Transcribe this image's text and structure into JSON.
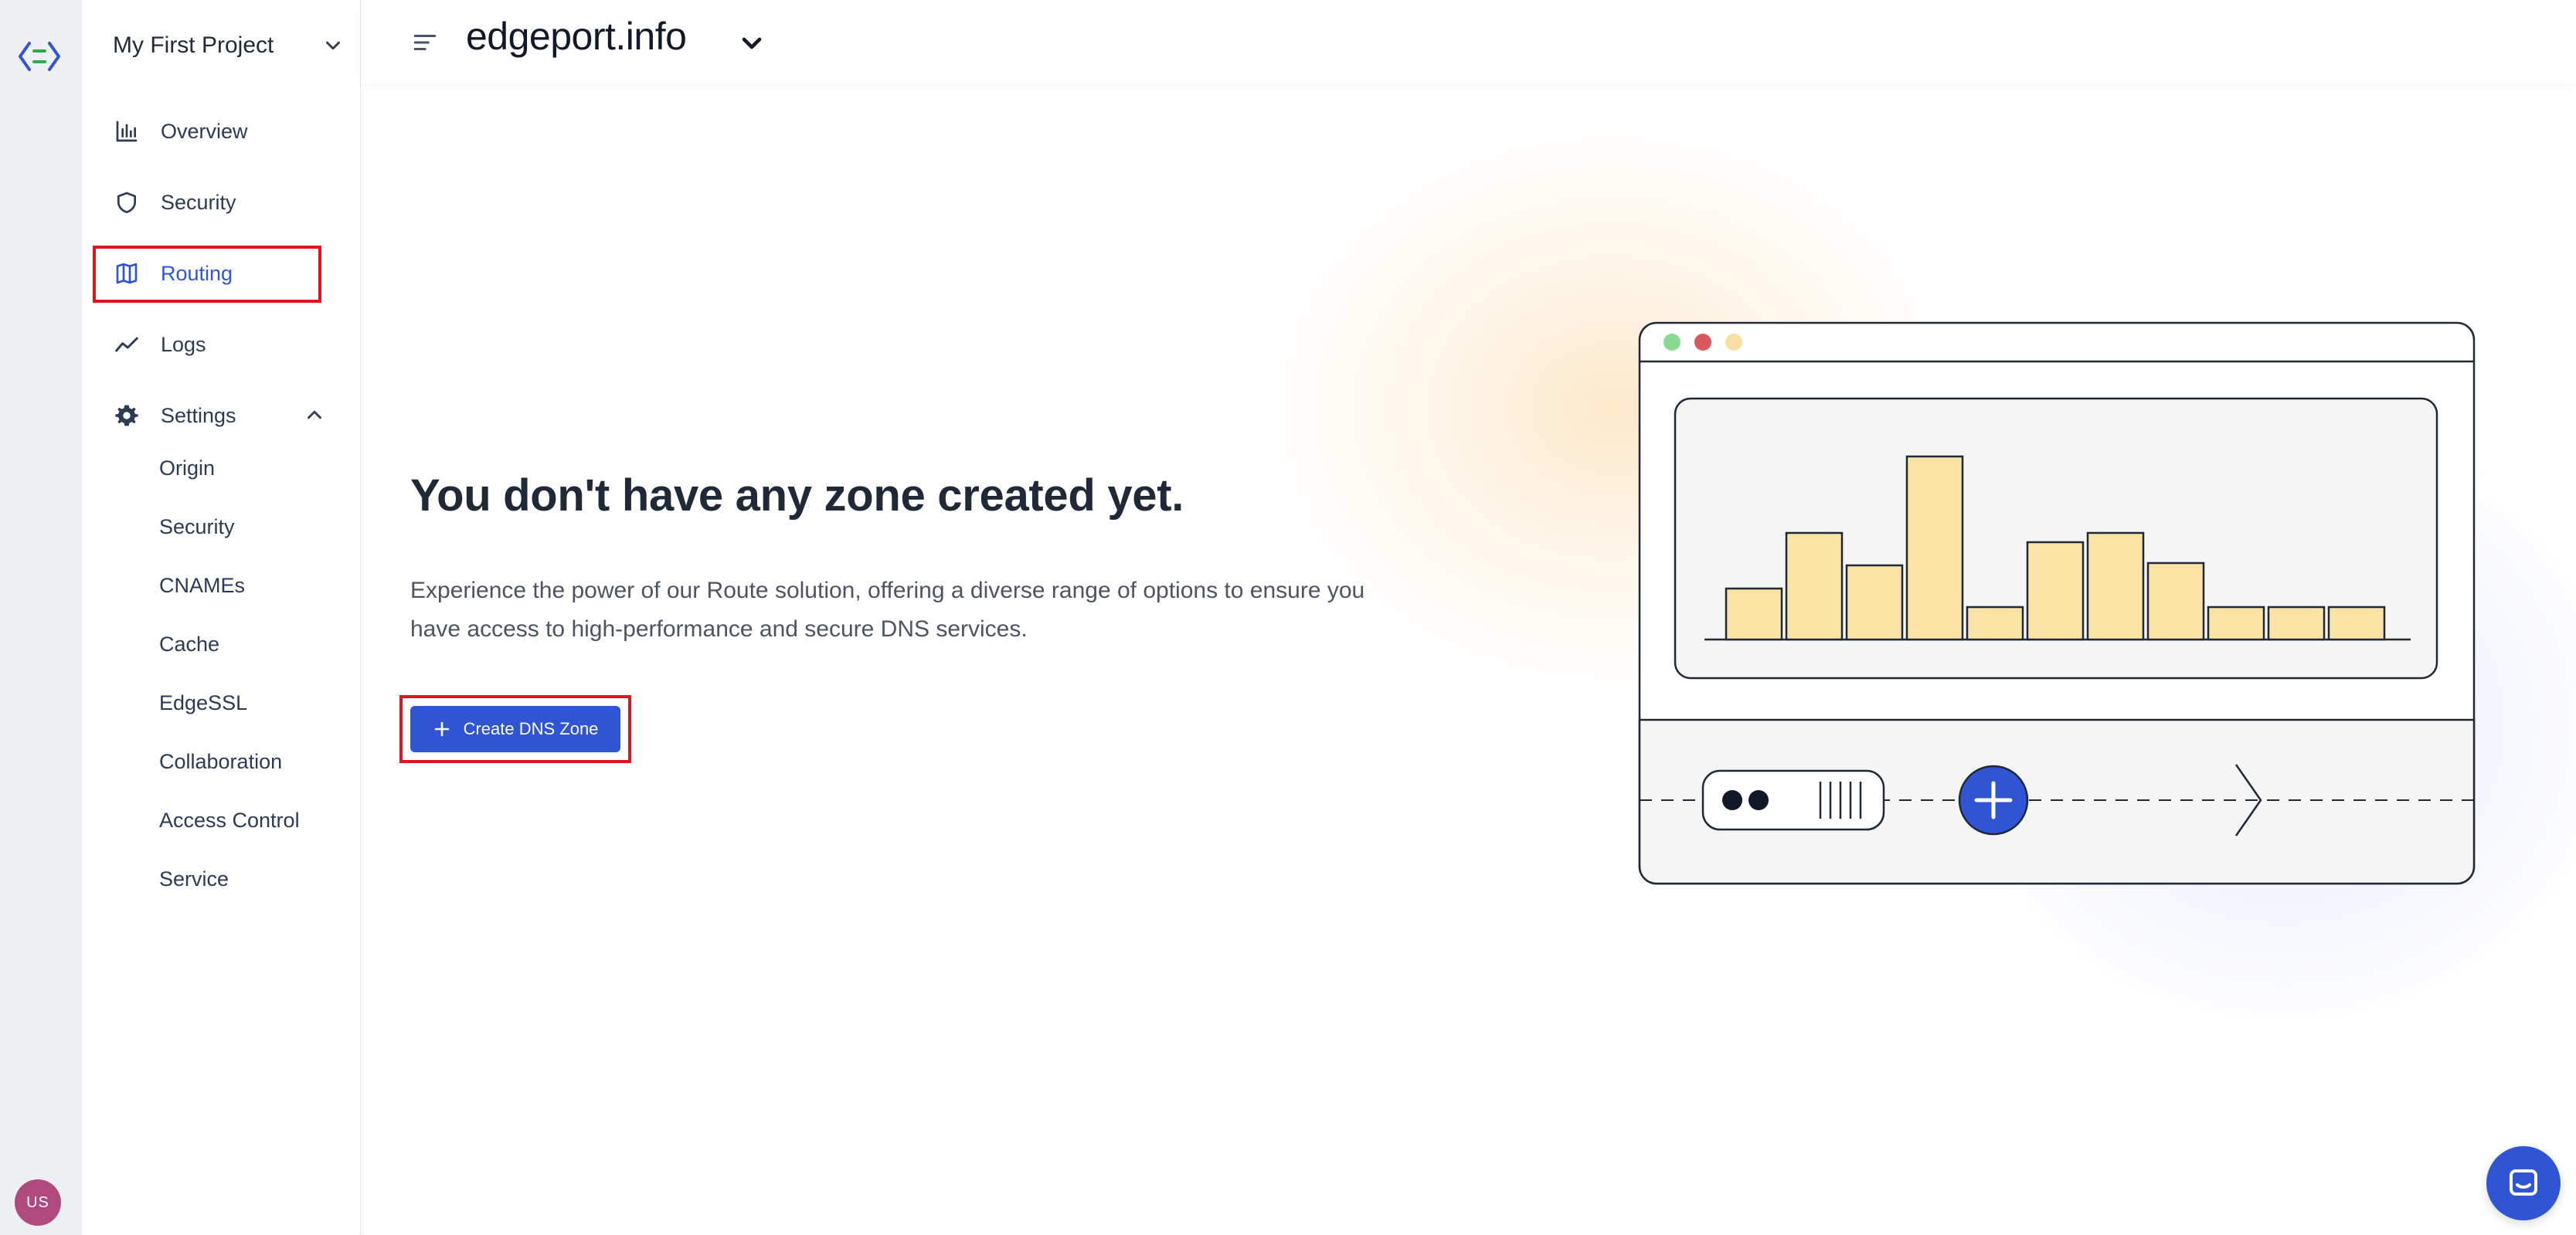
{
  "project": {
    "name": "My First Project"
  },
  "sidebar": {
    "items": [
      {
        "label": "Overview",
        "icon": "bar-chart-icon"
      },
      {
        "label": "Security",
        "icon": "shield-icon"
      },
      {
        "label": "Routing",
        "icon": "map-icon",
        "active": true
      },
      {
        "label": "Logs",
        "icon": "trend-line-icon"
      },
      {
        "label": "Settings",
        "icon": "gear-icon",
        "expanded": true
      }
    ],
    "settings_items": [
      "Origin",
      "Security",
      "CNAMEs",
      "Cache",
      "EdgeSSL",
      "Collaboration",
      "Access Control",
      "Service"
    ]
  },
  "header": {
    "title": "edgeport.info"
  },
  "main": {
    "heading": "You don't have any zone created yet.",
    "description": "Experience the power of our Route solution, offering a diverse range of options to ensure you have access to high-performance and secure DNS services.",
    "cta_label": "Create DNS Zone"
  },
  "user": {
    "initials": "US"
  },
  "colors": {
    "accent": "#2f55d4",
    "highlight": "#e0141e",
    "bar_fill": "#fbe3a6"
  },
  "illustration": {
    "bars": [
      0.22,
      0.46,
      0.32,
      0.79,
      0.14,
      0.42,
      0.46,
      0.33,
      0.14,
      0.14,
      0.14
    ]
  }
}
